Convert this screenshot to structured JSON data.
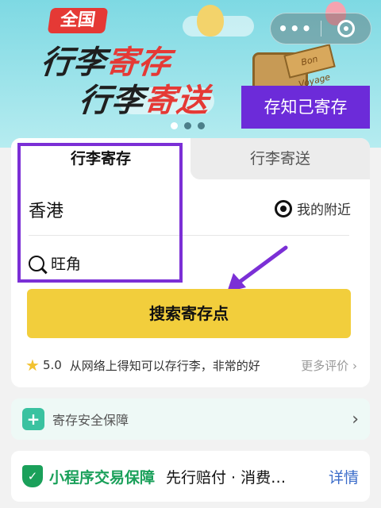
{
  "banner": {
    "tag": "全国",
    "line1_dark": "行李",
    "line1_red": "寄存",
    "line2_dark": "行李",
    "line2_red": "寄送",
    "sign_text": "Bon Voyage",
    "known_storage_button": "存知己寄存",
    "carousel_dots": 3,
    "carousel_active": 0
  },
  "capsule": {
    "more_label": "•••",
    "close_icon": "target-icon"
  },
  "tabs": {
    "active": "行李寄存",
    "inactive": "行李寄送"
  },
  "location": {
    "city": "香港",
    "nearby_label": "我的附近",
    "district": "旺角"
  },
  "search_button": "搜索寄存点",
  "review": {
    "score": "5.0",
    "text": "从网络上得知可以存行李，非常的好",
    "more": "更多评价",
    "more_chevron": "›"
  },
  "safety": {
    "label": "寄存安全保障",
    "chevron": "›"
  },
  "trade": {
    "title": "小程序交易保障",
    "desc": "先行赔付 · 消费…",
    "detail": "详情"
  },
  "colors": {
    "accent_purple": "#7b2fd6",
    "search_yellow": "#f2ce3c",
    "headline_red": "#e53935",
    "trade_green": "#1aa05a",
    "link_blue": "#3b6cc9"
  }
}
